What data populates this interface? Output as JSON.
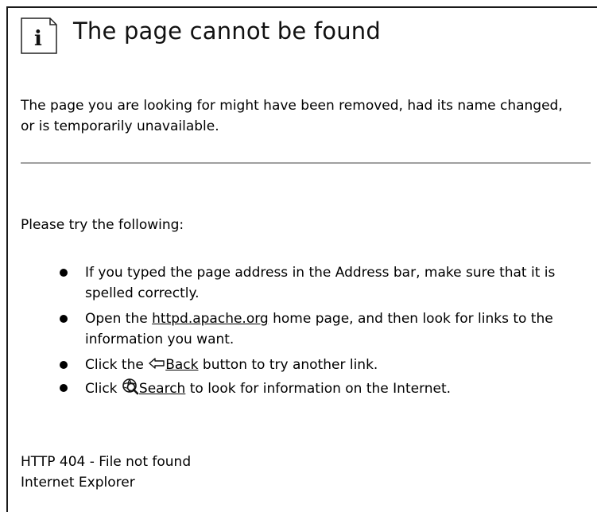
{
  "header": {
    "icon": "info-icon",
    "icon_glyph": "i",
    "title": "The page cannot be found"
  },
  "main": {
    "message": "The page you are looking for might have been removed, had its name changed, or is temporarily unavailable.",
    "try_heading": "Please try the following:",
    "suggestions": {
      "address": "If you typed the page address in the Address bar, make sure that it is spelled correctly.",
      "open_prefix": "Open the ",
      "home_link": "httpd.apache.org",
      "open_suffix": " home page, and then look for links to the information you want.",
      "click_prefix": "Click the ",
      "back_link": "Back",
      "back_suffix": " button to try another link.",
      "search_prefix": "Click ",
      "search_link": "Search",
      "search_suffix": " to look for information on the Internet."
    }
  },
  "footer": {
    "status": "HTTP 404 - File not found",
    "browser": "Internet Explorer"
  },
  "colors": {
    "frame": "#1a1a1a",
    "rule": "#a0a0a0",
    "text": "#000000"
  }
}
